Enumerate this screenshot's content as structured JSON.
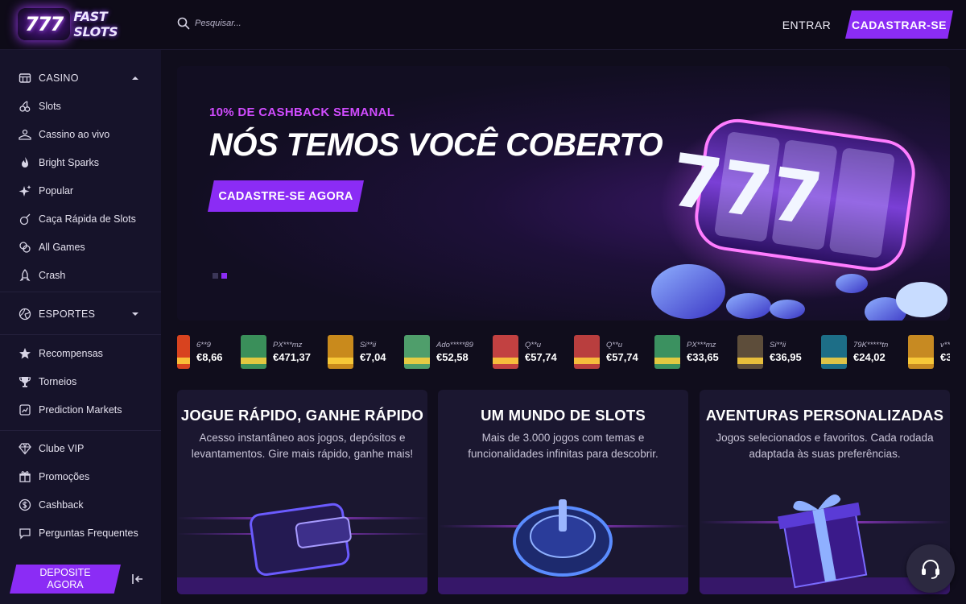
{
  "header": {
    "logo_number": "777",
    "logo_name": "FAST SLOTS",
    "search_placeholder": "Pesquisar...",
    "login_label": "ENTRAR",
    "register_label": "CADASTRAR-SE"
  },
  "sidebar": {
    "casino": {
      "label": "CASINO",
      "items": [
        {
          "label": "Slots",
          "icon": "cherries-icon"
        },
        {
          "label": "Cassino ao vivo",
          "icon": "live-dealer-icon"
        },
        {
          "label": "Bright Sparks",
          "icon": "flame-icon"
        },
        {
          "label": "Popular",
          "icon": "sparkle-icon"
        },
        {
          "label": "Caça Rápida de Slots",
          "icon": "bomb-icon"
        },
        {
          "label": "All Games",
          "icon": "games-icon"
        },
        {
          "label": "Crash",
          "icon": "rocket-icon"
        }
      ]
    },
    "sports": {
      "label": "ESPORTES"
    },
    "group2": [
      {
        "label": "Recompensas",
        "icon": "star-icon"
      },
      {
        "label": "Torneios",
        "icon": "trophy-icon"
      },
      {
        "label": "Prediction Markets",
        "icon": "chart-icon"
      }
    ],
    "group3": [
      {
        "label": "Clube VIP",
        "icon": "diamond-icon"
      },
      {
        "label": "Promoções",
        "icon": "gift-icon"
      },
      {
        "label": "Cashback",
        "icon": "coin-icon"
      },
      {
        "label": "Perguntas Frequentes",
        "icon": "chat-icon"
      }
    ],
    "deposit_label_1": "DEPOSITE",
    "deposit_label_2": "AGORA"
  },
  "hero": {
    "eyebrow": "10% DE CASHBACK SEMANAL",
    "title": "NÓS TEMOS VOCÊ COBERTO",
    "cta": "CADASTRE-SE AGORA",
    "art_text": "777"
  },
  "ticker": [
    {
      "user": "6**9",
      "amount": "€8,66",
      "color": "#d8431f"
    },
    {
      "user": "PX***mz",
      "amount": "€471,37",
      "color": "#3a8f5a"
    },
    {
      "user": "Si**ii",
      "amount": "€7,04",
      "color": "#c98a1c"
    },
    {
      "user": "Ado*****89",
      "amount": "€52,58",
      "color": "#4f9e6b"
    },
    {
      "user": "Q**u",
      "amount": "€57,74",
      "color": "#c24141"
    },
    {
      "user": "Q**u",
      "amount": "€57,74",
      "color": "#b93e3e"
    },
    {
      "user": "PX***mz",
      "amount": "€33,65",
      "color": "#3b9160"
    },
    {
      "user": "Si**ii",
      "amount": "€36,95",
      "color": "#5d4d3a"
    },
    {
      "user": "79K*****tn",
      "amount": "€24,02",
      "color": "#1d6e87"
    },
    {
      "user": "v**",
      "amount": "€3",
      "color": "#c78a22"
    }
  ],
  "cards": [
    {
      "title": "JOGUE RÁPIDO, GANHE RÁPIDO",
      "desc": "Acesso instantâneo aos jogos, depósitos e levantamentos. Gire mais rápido, ganhe mais!"
    },
    {
      "title": "UM MUNDO DE SLOTS",
      "desc": "Mais de 3.000 jogos com temas e funcionalidades infinitas para descobrir."
    },
    {
      "title": "AVENTURAS PERSONALIZADAS",
      "desc": "Jogos selecionados e favoritos. Cada rodada adaptada às suas preferências."
    }
  ]
}
